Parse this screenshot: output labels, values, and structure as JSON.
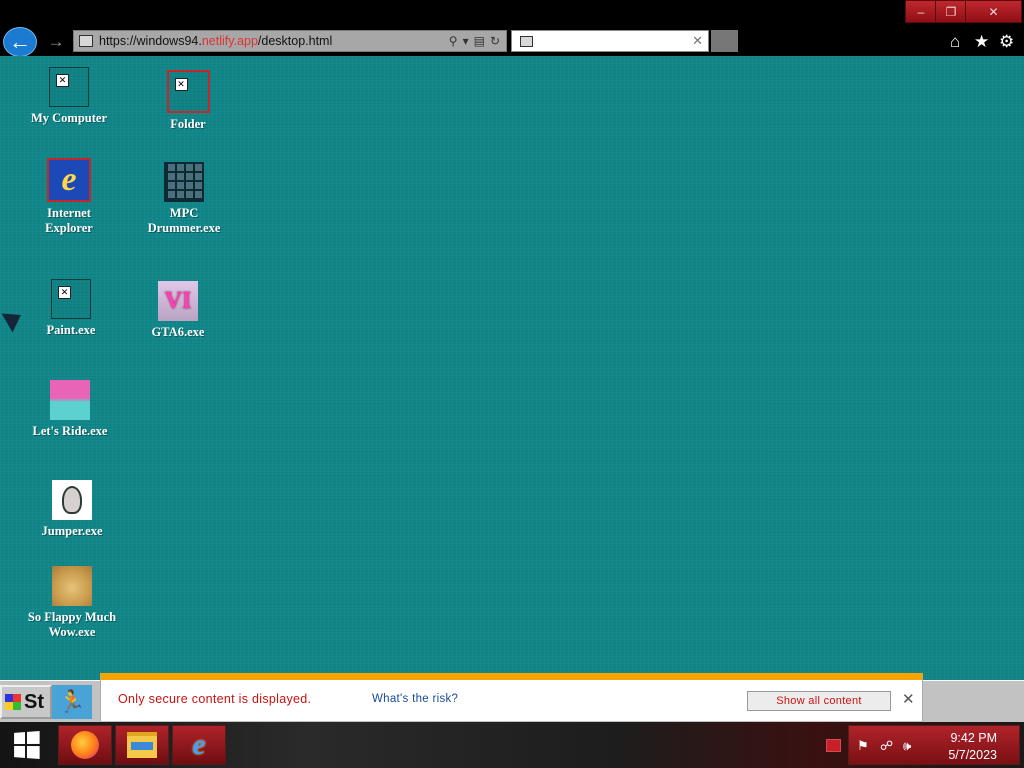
{
  "browser": {
    "url_prefix": "https://windows94.",
    "url_highlight": "netlify.app",
    "url_suffix": "/desktop.html",
    "tab_title": "",
    "window_controls": [
      "–",
      "❐",
      "✕"
    ]
  },
  "desktop": {
    "icons": [
      {
        "label": "My Computer"
      },
      {
        "label": "Folder"
      },
      {
        "label": "Internet Explorer",
        "glyph": "e"
      },
      {
        "label": "MPC Drummer.exe"
      },
      {
        "label": "Paint.exe"
      },
      {
        "label": "GTA6.exe",
        "glyph": "VI"
      },
      {
        "label": "Let's Ride.exe"
      },
      {
        "label": "Jumper.exe"
      },
      {
        "label": "So Flappy Much Wow.exe"
      }
    ]
  },
  "w94_taskbar": {
    "start_label": "St"
  },
  "notification": {
    "message": "Only secure content is displayed.",
    "risk_link": "What's the risk?",
    "show_all": "Show all content"
  },
  "taskbar": {
    "apps": [
      "firefox-icon",
      "file-explorer-icon",
      "internet-explorer-icon"
    ],
    "time": "9:42 PM",
    "date": "5/7/2023"
  }
}
